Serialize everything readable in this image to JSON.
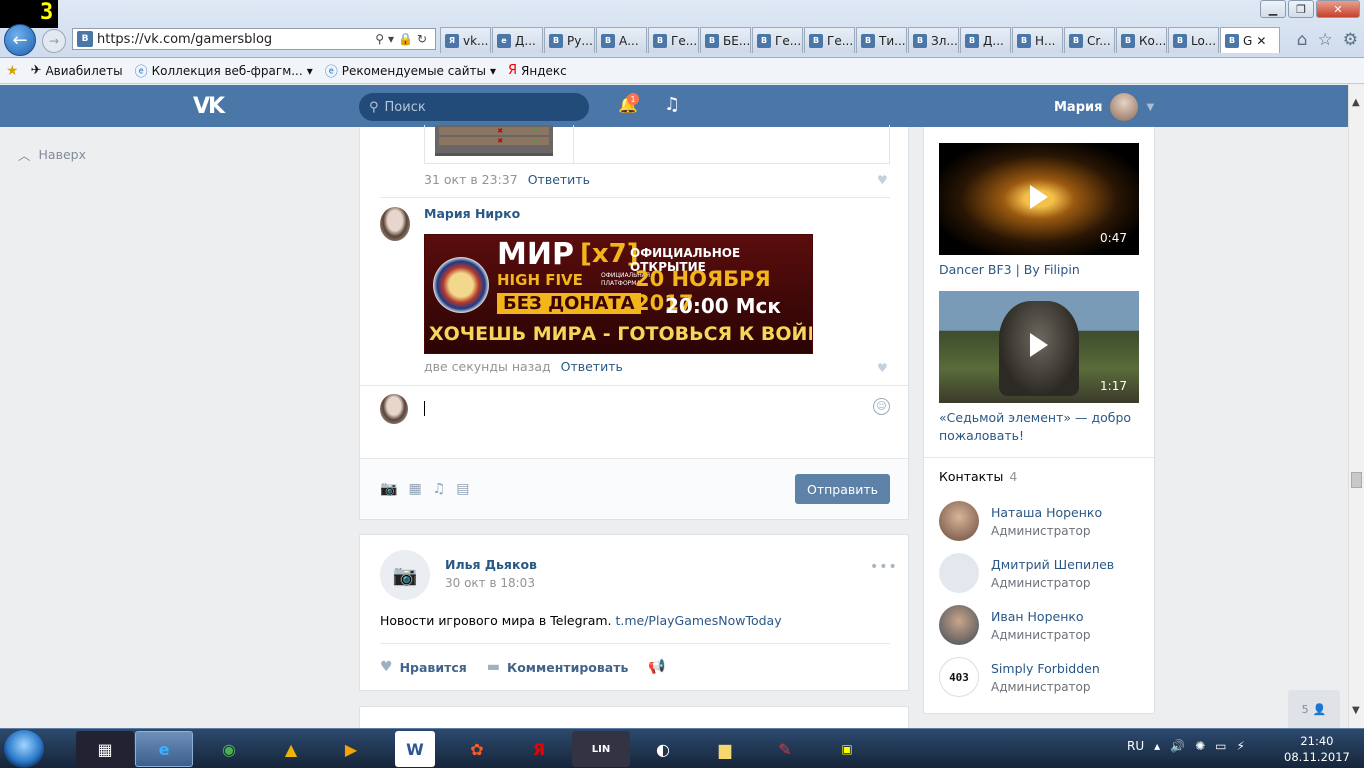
{
  "browser": {
    "badge": "3",
    "url": "https://vk.com/gamersblog",
    "tabs": [
      "vk...",
      "Д...",
      "Ру...",
      "А...",
      "Ге...",
      "БЕ...",
      "Ге...",
      "Ге...",
      "Ти...",
      "Зл...",
      "Д...",
      "Н...",
      "Cr...",
      "Ко...",
      "Lo...",
      "G"
    ],
    "favorites": [
      {
        "label": "Авиабилеты",
        "icon": "plane-icon"
      },
      {
        "label": "Коллекция веб-фрагм...",
        "icon": "web-slice-icon"
      },
      {
        "label": "Рекомендуемые сайты",
        "icon": "suggested-sites-icon"
      },
      {
        "label": "Яндекс",
        "icon": "yandex-icon"
      }
    ]
  },
  "vk": {
    "logo": "VK",
    "search_placeholder": "Поиск",
    "notifications_count": "1",
    "user_name": "Мария",
    "up_link": "Наверх"
  },
  "comments": [
    {
      "date": "31 окт в 23:37",
      "reply": "Ответить"
    },
    {
      "author": "Мария Нирко",
      "date": "две секунды назад",
      "reply": "Ответить",
      "banner": {
        "mir": "МИР",
        "x7": "[x7]",
        "opening": "ОФИЦИАЛЬНОЕ ОТКРЫТИЕ",
        "hf": "HIGH FIVE",
        "platform": "ОФИЦИАЛЬНАЯ ПЛАТФОРМА",
        "date": "20 НОЯБРЯ 2017",
        "no_donate": "БЕЗ ДОНАТА",
        "time": "20:00 Мск",
        "slogan": "ХОЧЕШЬ МИРА - ГОТОВЬСЯ К ВОЙНЕ"
      }
    }
  ],
  "composer": {
    "send": "Отправить"
  },
  "post2": {
    "author": "Илья Дьяков",
    "date": "30 окт в 18:03",
    "text": "Новости игрового мира в Telegram. ",
    "link": "t.me/PlayGamesNowToday",
    "like": "Нравится",
    "comment": "Комментировать"
  },
  "right": {
    "videos": [
      {
        "title": "Dancer BF3 | By Filipin",
        "duration": "0:47"
      },
      {
        "title": "«Седьмой элемент» — добро пожаловать!",
        "duration": "1:17"
      }
    ],
    "contacts_title": "Контакты",
    "contacts_count": "4",
    "contacts": [
      {
        "name": "Наташа Норенко",
        "role": "Администратор"
      },
      {
        "name": "Дмитрий Шепилев",
        "role": "Администратор"
      },
      {
        "name": "Иван Норенко",
        "role": "Администратор"
      },
      {
        "name": "Simply Forbidden",
        "role": "Администратор"
      }
    ],
    "friends_online": "5"
  },
  "taskbar": {
    "lang": "RU",
    "time": "21:40",
    "date": "08.11.2017"
  }
}
